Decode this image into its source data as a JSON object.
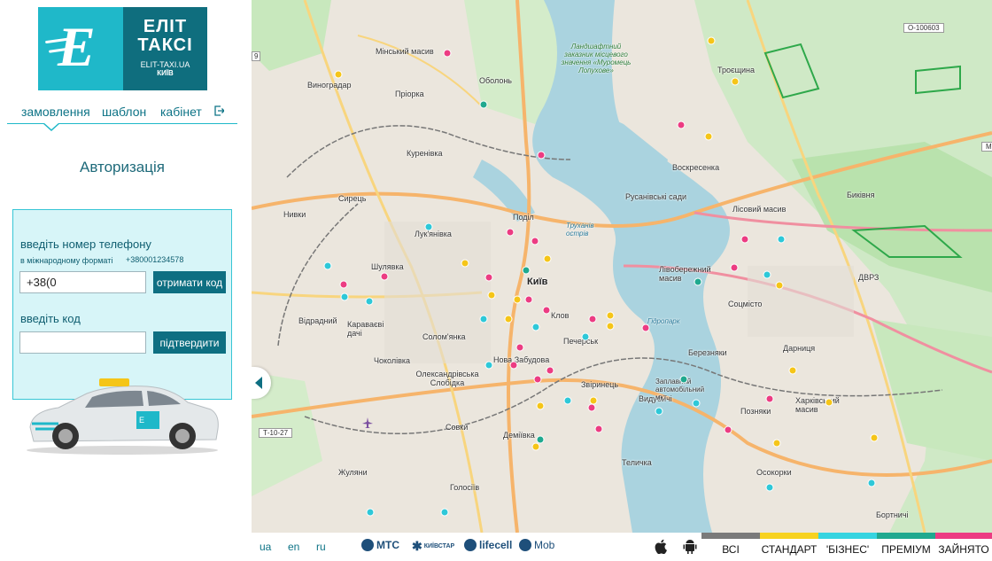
{
  "logo": {
    "title_line1": "ЕЛІТ",
    "title_line2": "ТАКСІ",
    "site": "ELIT-TAXI.UA",
    "city": "КИЇВ"
  },
  "nav": {
    "items": [
      {
        "label": "замовлення"
      },
      {
        "label": "шаблон"
      },
      {
        "label": "кабінет"
      }
    ],
    "exit_icon": "logout-icon"
  },
  "auth": {
    "title": "Авторизація",
    "phone_label": "введіть номер телефону",
    "phone_hint": "в міжнародному форматі",
    "phone_example": "+380001234578",
    "phone_value": "+38(0",
    "get_code_button": "отримати код",
    "code_label": "введіть код",
    "code_value": "",
    "confirm_button": "підтвердити"
  },
  "taxi_image": {
    "plate": "",
    "icon": "taxi-car-illustration"
  },
  "map": {
    "labels": [
      {
        "text": "Мінський масив",
        "cls": ""
      },
      {
        "text": "Оболонь",
        "cls": ""
      },
      {
        "text": "Виноградар",
        "cls": ""
      },
      {
        "text": "Пріорка",
        "cls": ""
      },
      {
        "text": "Ландшафтний заказник місцевого значення «Муромець Лопухове»",
        "cls": "park"
      },
      {
        "text": "Троєщина",
        "cls": ""
      },
      {
        "text": "Куренівка",
        "cls": ""
      },
      {
        "text": "Воскресенка",
        "cls": ""
      },
      {
        "text": "Сирець",
        "cls": ""
      },
      {
        "text": "Русанівські сади",
        "cls": ""
      },
      {
        "text": "Биківня",
        "cls": ""
      },
      {
        "text": "Нивки",
        "cls": ""
      },
      {
        "text": "Поділ",
        "cls": ""
      },
      {
        "text": "Труханів острів",
        "cls": "water"
      },
      {
        "text": "Лісовий масив",
        "cls": ""
      },
      {
        "text": "Лук'янівка",
        "cls": ""
      },
      {
        "text": "Шулявка",
        "cls": ""
      },
      {
        "text": "Київ",
        "cls": "big"
      },
      {
        "text": "Лівобережний масив",
        "cls": ""
      },
      {
        "text": "ДВРЗ",
        "cls": ""
      },
      {
        "text": "Соцмісто",
        "cls": ""
      },
      {
        "text": "Відрадний",
        "cls": ""
      },
      {
        "text": "Караваєві дачі",
        "cls": ""
      },
      {
        "text": "Клов",
        "cls": ""
      },
      {
        "text": "Гідропарк",
        "cls": "water"
      },
      {
        "text": "Солом'янка",
        "cls": ""
      },
      {
        "text": "Печерськ",
        "cls": ""
      },
      {
        "text": "Березняки",
        "cls": ""
      },
      {
        "text": "Дарниця",
        "cls": ""
      },
      {
        "text": "Чоколівка",
        "cls": ""
      },
      {
        "text": "Нова Забудова",
        "cls": ""
      },
      {
        "text": "Олександрівська Слобідка",
        "cls": ""
      },
      {
        "text": "Звіринець",
        "cls": ""
      },
      {
        "text": "Видубичі",
        "cls": ""
      },
      {
        "text": "Заплавний автомобільний мкт",
        "cls": ""
      },
      {
        "text": "Харківський масив",
        "cls": ""
      },
      {
        "text": "Позняки",
        "cls": ""
      },
      {
        "text": "Совки",
        "cls": ""
      },
      {
        "text": "Деміївка",
        "cls": ""
      },
      {
        "text": "Жуляни",
        "cls": ""
      },
      {
        "text": "Теличка",
        "cls": ""
      },
      {
        "text": "Осокорки",
        "cls": ""
      },
      {
        "text": "Голосіїв",
        "cls": ""
      },
      {
        "text": "Бортничі",
        "cls": ""
      }
    ],
    "road_signs": [
      "О-100603",
      "М-",
      "Т-10-27",
      "9"
    ],
    "collapse_icon": "collapse-left-icon",
    "airport_icon": "airplane-icon"
  },
  "footer": {
    "languages": [
      "ua",
      "en",
      "ru"
    ],
    "operators": [
      "МТС",
      "КИЇВСТАР",
      "lifecell",
      "Mob"
    ],
    "apps": [
      "apple-icon",
      "android-icon"
    ],
    "filters": [
      {
        "label": "ВСІ",
        "color": "#7a7a7a"
      },
      {
        "label": "СТАНДАРТ",
        "color": "#f7d21f"
      },
      {
        "label": "'БІЗНЕС'",
        "color": "#35d4e0"
      },
      {
        "label": "ПРЕМІУМ",
        "color": "#1fa98f"
      },
      {
        "label": "ЗАЙНЯТО",
        "color": "#ec3c82"
      }
    ]
  },
  "colors": {
    "brand_teal": "#1fb8c9",
    "brand_dark": "#0f6e7e",
    "marker_yellow": "#f5c518",
    "marker_pink": "#ec3c82",
    "marker_cyan": "#2ec8d8",
    "marker_green": "#1fa98f"
  }
}
